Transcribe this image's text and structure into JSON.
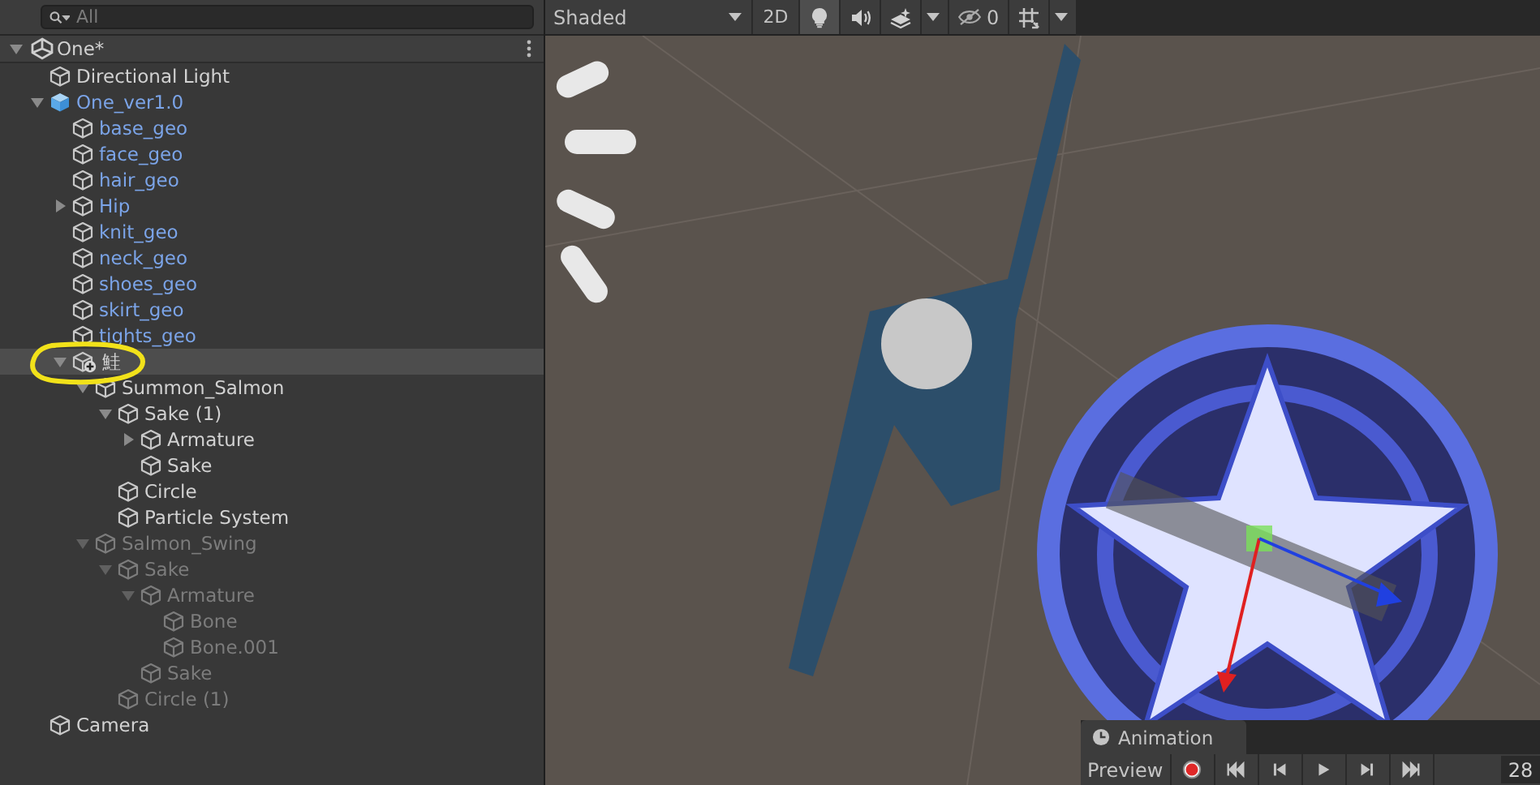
{
  "hierarchy": {
    "search": {
      "placeholder": "All"
    },
    "scene": {
      "title": "One*",
      "expanded": true
    },
    "items": [
      {
        "label": "Directional Light",
        "kind": "object",
        "disabled": false,
        "selected": false
      },
      {
        "label": "One_ver1.0",
        "kind": "prefab_root",
        "disabled": false,
        "selected": false,
        "expanded": true,
        "children": [
          {
            "label": "base_geo",
            "kind": "prefab_part",
            "disabled": false,
            "selected": false
          },
          {
            "label": "face_geo",
            "kind": "prefab_part",
            "disabled": false,
            "selected": false
          },
          {
            "label": "hair_geo",
            "kind": "prefab_part",
            "disabled": false,
            "selected": false
          },
          {
            "label": "Hip",
            "kind": "prefab_part",
            "disabled": false,
            "selected": false,
            "expanded": false
          },
          {
            "label": "knit_geo",
            "kind": "prefab_part",
            "disabled": false,
            "selected": false
          },
          {
            "label": "neck_geo",
            "kind": "prefab_part",
            "disabled": false,
            "selected": false
          },
          {
            "label": "shoes_geo",
            "kind": "prefab_part",
            "disabled": false,
            "selected": false
          },
          {
            "label": "skirt_geo",
            "kind": "prefab_part",
            "disabled": false,
            "selected": false
          },
          {
            "label": "tights_geo",
            "kind": "prefab_part",
            "disabled": false,
            "selected": false
          },
          {
            "label": "鮭",
            "kind": "added_object",
            "disabled": false,
            "selected": true,
            "expanded": true,
            "children": [
              {
                "label": "Summon_Salmon",
                "kind": "object",
                "disabled": false,
                "selected": false,
                "expanded": true,
                "children": [
                  {
                    "label": "Sake (1)",
                    "kind": "object",
                    "disabled": false,
                    "selected": false,
                    "expanded": true,
                    "children": [
                      {
                        "label": "Armature",
                        "kind": "object",
                        "disabled": false,
                        "selected": false,
                        "expanded": false
                      },
                      {
                        "label": "Sake",
                        "kind": "object",
                        "disabled": false,
                        "selected": false
                      }
                    ]
                  },
                  {
                    "label": "Circle",
                    "kind": "object",
                    "disabled": false,
                    "selected": false
                  },
                  {
                    "label": "Particle System",
                    "kind": "object",
                    "disabled": false,
                    "selected": false
                  }
                ]
              },
              {
                "label": "Salmon_Swing",
                "kind": "object",
                "disabled": true,
                "selected": false,
                "expanded": true,
                "children": [
                  {
                    "label": "Sake",
                    "kind": "object",
                    "disabled": true,
                    "selected": false,
                    "expanded": true,
                    "children": [
                      {
                        "label": "Armature",
                        "kind": "object",
                        "disabled": true,
                        "selected": false,
                        "expanded": true,
                        "children": [
                          {
                            "label": "Bone",
                            "kind": "object",
                            "disabled": true,
                            "selected": false
                          },
                          {
                            "label": "Bone.001",
                            "kind": "object",
                            "disabled": true,
                            "selected": false
                          }
                        ]
                      },
                      {
                        "label": "Sake",
                        "kind": "object",
                        "disabled": true,
                        "selected": false
                      }
                    ]
                  },
                  {
                    "label": "Circle (1)",
                    "kind": "object",
                    "disabled": true,
                    "selected": false
                  }
                ]
              }
            ]
          }
        ]
      },
      {
        "label": "Camera",
        "kind": "object",
        "disabled": false,
        "selected": false
      }
    ]
  },
  "scene_toolbar": {
    "shading": {
      "value": "Shaded"
    },
    "mode_2d": {
      "label": "2D",
      "on": false
    },
    "toggles": [
      {
        "kind": "lighting",
        "on": true
      },
      {
        "kind": "audio",
        "on": false
      },
      {
        "kind": "effects",
        "on": false
      }
    ],
    "hidden": {
      "count": "0",
      "on": false
    },
    "grid": {
      "on": false
    }
  },
  "animation": {
    "tab": {
      "label": "Animation",
      "selected": true
    },
    "preview": {
      "label": "Preview"
    },
    "controls": [
      {
        "kind": "record"
      },
      {
        "kind": "first"
      },
      {
        "kind": "prev"
      },
      {
        "kind": "play"
      },
      {
        "kind": "next"
      },
      {
        "kind": "last"
      }
    ],
    "frame": {
      "value": "28"
    }
  }
}
